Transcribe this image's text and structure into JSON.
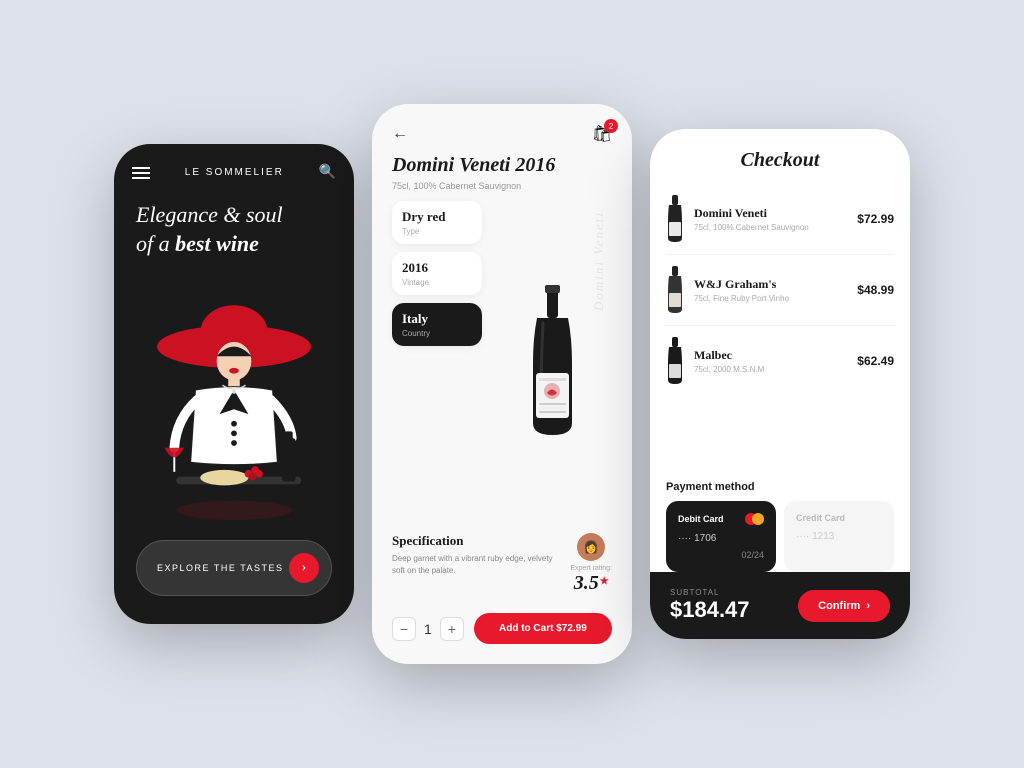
{
  "phone1": {
    "brand": "LE SOMMELIER",
    "hero_line1": "Elegance & soul",
    "hero_line2": "of a",
    "hero_bold": "best wine",
    "explore_label": "EXPLORE THE TASTES"
  },
  "phone2": {
    "back_label": "←",
    "cart_count": "2",
    "wine_name": "Domini Veneti",
    "wine_year": "2016",
    "wine_sub": "75cl, 100% Cabernet Sauvignon",
    "type_val": "Dry red",
    "type_label": "Type",
    "vintage_val": "2016",
    "vintage_label": "Vintage",
    "country_val": "Italy",
    "country_label": "Country",
    "bottle_watermark": "Domini Veneti",
    "spec_title": "Specification",
    "spec_desc": "Deep garnet with a vibrant ruby edge, velvety soft on the palate.",
    "expert_label": "Expert rating:",
    "expert_rating": "3.5",
    "qty_label": "1",
    "add_cart_label": "Add to Cart",
    "price": "$72.99"
  },
  "phone3": {
    "title": "Checkout",
    "items": [
      {
        "name": "Domini Veneti",
        "desc": "75cl, 100% Cabernet Sauvignon",
        "price": "$72.99"
      },
      {
        "name": "W&J Graham's",
        "desc": "75cl, Fine Ruby Port Vinho",
        "price": "$48.99"
      },
      {
        "name": "Malbec",
        "desc": "75cl, 2000 M.S.N.M",
        "price": "$62.49"
      }
    ],
    "payment_title": "Payment method",
    "card1_label": "Debit Card",
    "card1_number": "···· 1706",
    "card1_expiry": "02/24",
    "card2_label": "Credit Card",
    "card2_number": "···· 1213",
    "subtotal_label": "SUBTOTAL",
    "subtotal_amount": "$184.47",
    "confirm_label": "Confirm"
  }
}
